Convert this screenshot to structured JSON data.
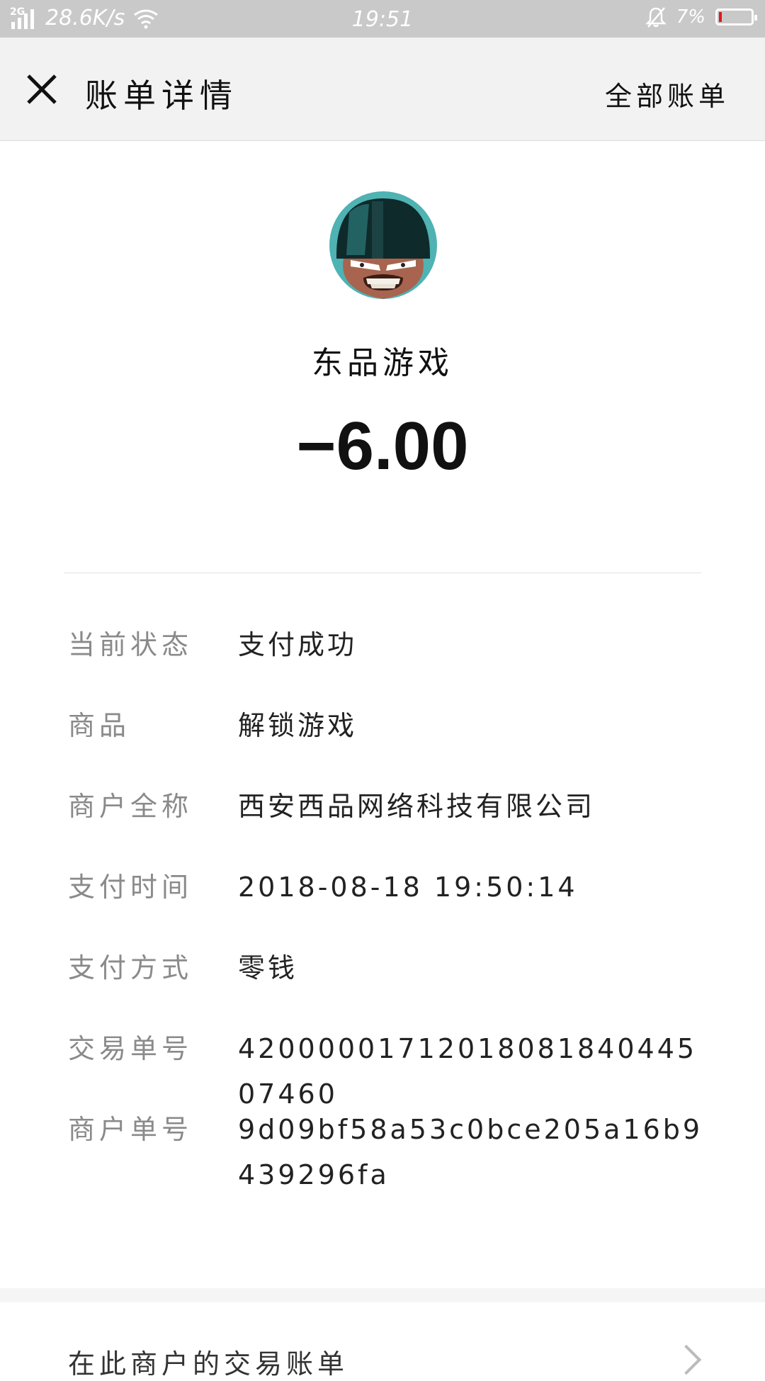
{
  "status_bar": {
    "network": "2G",
    "speed": "28.6K/s",
    "time": "19:51",
    "battery": "7%",
    "icons": [
      "signal-icon",
      "wifi-icon",
      "bell-muted-icon",
      "battery-icon"
    ]
  },
  "header": {
    "title": "账单详情",
    "right_action": "全部账单"
  },
  "merchant": {
    "name": "东品游戏",
    "amount": "−6.00"
  },
  "details": [
    {
      "label": "当前状态",
      "value": "支付成功"
    },
    {
      "label": "商品",
      "value": "解锁游戏"
    },
    {
      "label": "商户全称",
      "value": "西安西品网络科技有限公司"
    },
    {
      "label": "支付时间",
      "value": "2018-08-18 19:50:14"
    },
    {
      "label": "支付方式",
      "value": "零钱"
    },
    {
      "label": "交易单号",
      "value": "4200000171201808184044507460"
    },
    {
      "label": "商户单号",
      "value": "9d09bf58a53c0bce205a16b9439296fa"
    }
  ],
  "bottom": {
    "link_label": "在此商户的交易账单"
  },
  "colors": {
    "status_bar_bg": "#c9c9c9",
    "header_bg": "#f2f2f2",
    "label_gray": "#8a8a8a",
    "battery_low": "#e01818"
  }
}
